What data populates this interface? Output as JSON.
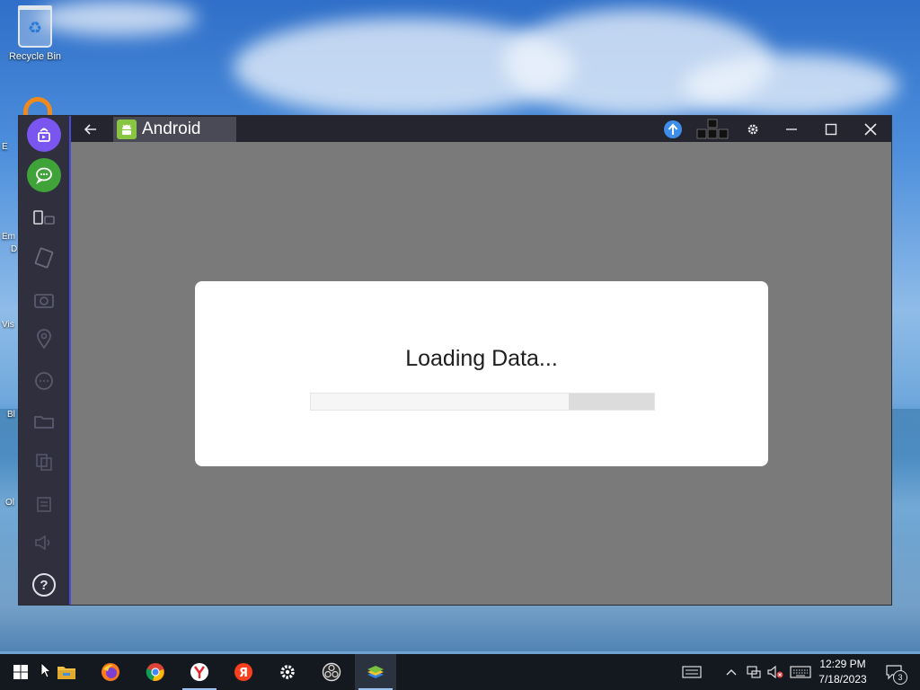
{
  "desktop": {
    "recycle_bin_label": "Recycle Bin",
    "partial_labels": [
      "E",
      "Em",
      "D",
      "Vis",
      "Bl",
      "Ol"
    ]
  },
  "window": {
    "tab_title": "Android",
    "sidebar": {
      "items": [
        "media-manager-icon",
        "chat-icon",
        "multi-instance-icon",
        "rotate-icon",
        "screenshot-icon",
        "location-icon",
        "more-icon",
        "folder-icon",
        "copy-icon",
        "files-icon",
        "volume-icon",
        "help-icon"
      ],
      "help_label": "?"
    },
    "titlebar_icons": [
      "back-arrow-icon",
      "upgrade-icon",
      "keymapping-icon",
      "settings-icon",
      "minimize-icon",
      "maximize-icon",
      "close-icon"
    ]
  },
  "dialog": {
    "loading_text": "Loading Data...",
    "progress_segment_start": 0.75,
    "progress_segment_end": 1.0
  },
  "taskbar": {
    "apps": [
      "start-icon",
      "file-explorer-icon",
      "firefox-icon",
      "chrome-icon",
      "yandex-browser-icon",
      "yandex-icon",
      "settings-icon",
      "obs-icon",
      "bluestacks-icon"
    ],
    "time": "12:29 PM",
    "date": "7/18/2023",
    "notification_count": "3"
  },
  "colors": {
    "sidebar_bg": "#2f2f3d",
    "titlebar_bg": "#25252f",
    "accent_purple": "#7a55ef",
    "accent_green": "#3fa33a",
    "android_green": "#88c540",
    "upgrade_blue": "#3d8ee8",
    "content_gray": "#7a7a7a",
    "taskbar_bg": "#141920"
  }
}
